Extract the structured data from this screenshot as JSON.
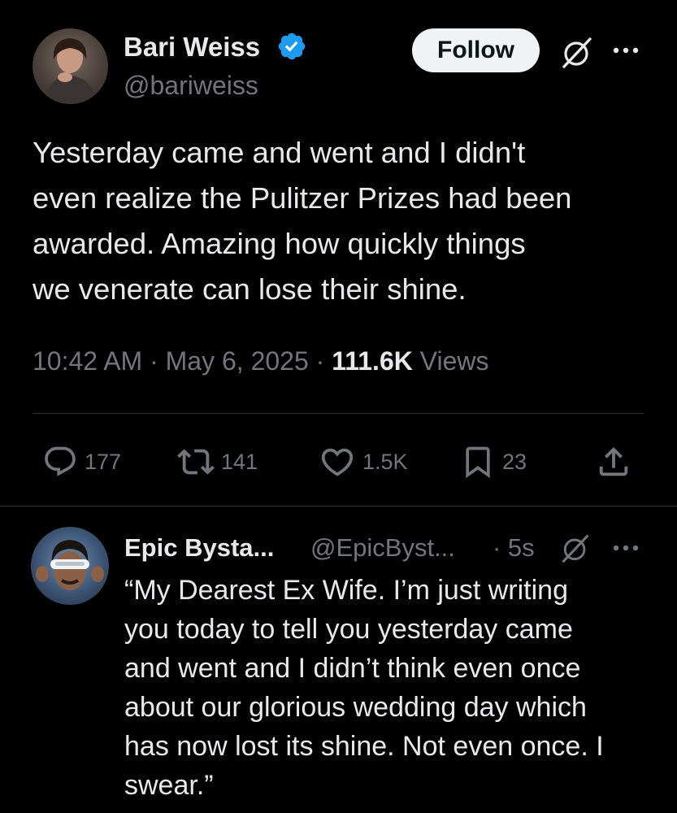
{
  "main_tweet": {
    "author": {
      "display_name": "Bari Weiss",
      "handle": "@bariweiss",
      "verified": true
    },
    "follow_label": "Follow",
    "text_lines": [
      "Yesterday came and went and I didn't",
      "even realize the Pulitzer Prizes had been",
      "awarded. Amazing how quickly things",
      "we venerate can lose their shine."
    ],
    "time": "10:42 AM",
    "date": "May 6, 2025",
    "separator": "·",
    "views_count": "111.6K",
    "views_label": "Views",
    "actions": {
      "replies": "177",
      "retweets": "141",
      "likes": "1.5K",
      "bookmarks": "23"
    }
  },
  "reply_tweet": {
    "author": {
      "display_name": "Epic Bysta...",
      "handle": "@EpicByst...",
      "time": "· 5s"
    },
    "text_lines": [
      "“My Dearest Ex Wife. I’m just writing",
      "you today to tell you yesterday came",
      "and went and I didn’t think even once",
      "about our glorious wedding day which",
      "has now lost its shine. Not even once. I",
      "swear.”"
    ]
  },
  "colors": {
    "background": "#000000",
    "text_primary": "#e7e9ea",
    "text_secondary": "#71767b",
    "verified_blue": "#1d9bf0",
    "divider": "#2f3336",
    "follow_bg": "#eff3f4"
  },
  "icons": [
    "verified-badge-icon",
    "grok-icon",
    "more-icon",
    "reply-icon",
    "retweet-icon",
    "like-icon",
    "bookmark-icon",
    "share-icon"
  ]
}
